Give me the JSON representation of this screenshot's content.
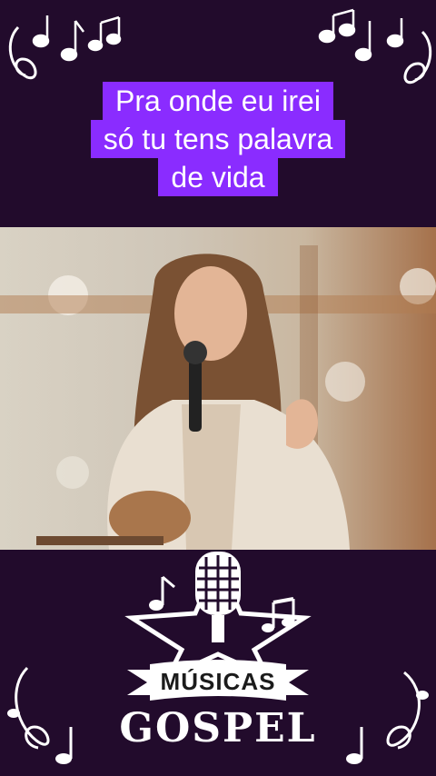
{
  "caption": {
    "line1": "Pra onde eu irei",
    "line2": "só tu tens palavra",
    "line3": "de vida"
  },
  "logo": {
    "banner_text": "MÚSICAS",
    "main_text": "GOSPEL"
  },
  "colors": {
    "background": "#220b2c",
    "caption_bg": "#8a2cff",
    "caption_text": "#ffffff"
  },
  "icons": [
    "music-notes-icon",
    "microphone-icon",
    "star-icon",
    "treble-clef-icon"
  ]
}
